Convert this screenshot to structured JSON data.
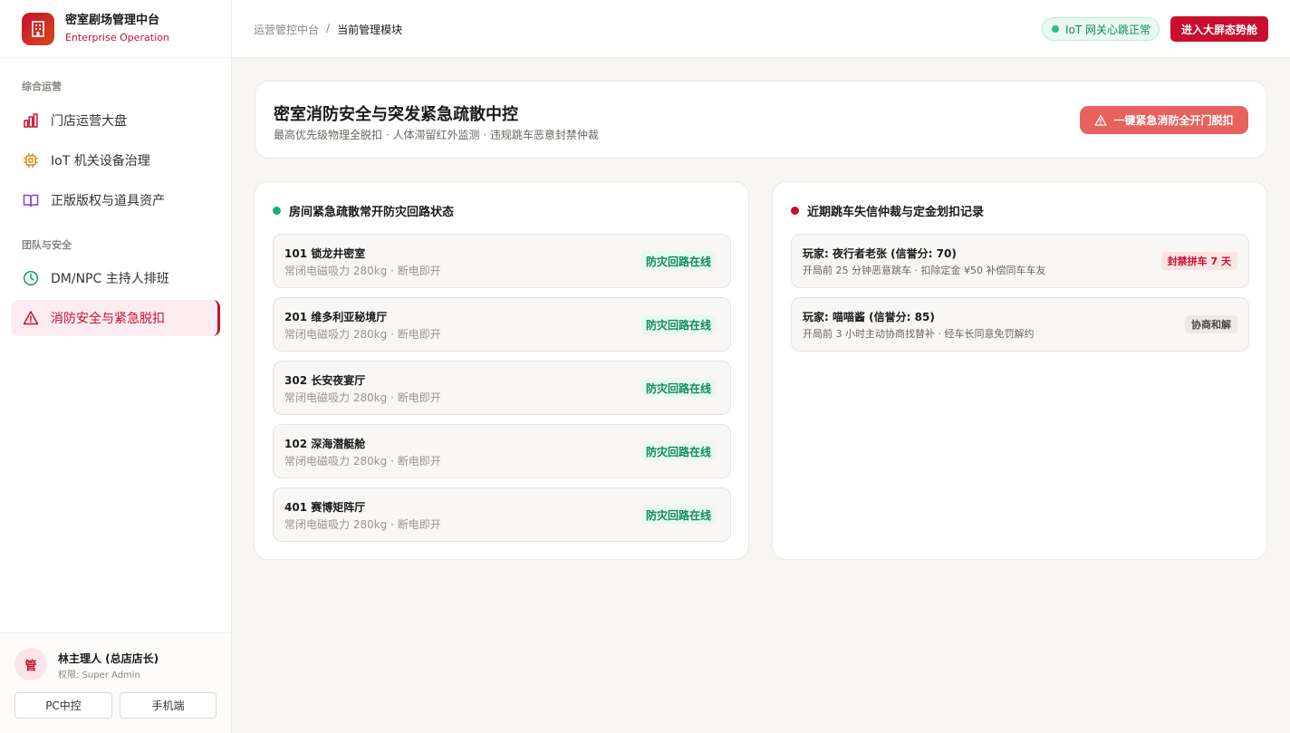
{
  "brand": {
    "title": "密室剧场管理中台",
    "subtitle": "Enterprise Operation"
  },
  "sidebar": {
    "sections": [
      {
        "label": "综合运营"
      },
      {
        "label": "团队与安全"
      }
    ],
    "items": [
      {
        "label": "门店运营大盘",
        "icon": "bar-chart-icon"
      },
      {
        "label": "IoT 机关设备治理",
        "icon": "chip-icon"
      },
      {
        "label": "正版版权与道具资产",
        "icon": "book-icon"
      },
      {
        "label": "DM/NPC 主持人排班",
        "icon": "clock-icon"
      },
      {
        "label": "消防安全与紧急脱扣",
        "icon": "warning-icon",
        "active": true
      }
    ]
  },
  "user": {
    "avatar_text": "管",
    "name": "林主理人 (总店店长)",
    "role": "权限: Super Admin",
    "buttons": [
      "PC中控",
      "手机端"
    ]
  },
  "header": {
    "breadcrumb": [
      "运营管控中台",
      "当前管理模块"
    ],
    "breadcrumb_sep": "/",
    "status": "IoT 网关心跳正常",
    "big_screen_button": "进入大屏态势舱"
  },
  "page": {
    "title": "密室消防安全与突发紧急疏散中控",
    "subtitle": "最高优先级物理全脱扣 · 人体滞留红外监测 · 违规跳车恶意封禁仲裁",
    "emergency_button": "一键紧急消防全开门脱扣"
  },
  "rooms_panel": {
    "title": "房间紧急疏散常开防灾回路状态",
    "dot_color": "#1aab74",
    "rooms": [
      {
        "name": "101 锁龙井密室",
        "desc": "常闭电磁吸力 280kg · 断电即开",
        "status": "防灾回路在线"
      },
      {
        "name": "201 维多利亚秘境厅",
        "desc": "常闭电磁吸力 280kg · 断电即开",
        "status": "防灾回路在线"
      },
      {
        "name": "302 长安夜宴厅",
        "desc": "常闭电磁吸力 280kg · 断电即开",
        "status": "防灾回路在线"
      },
      {
        "name": "102 深海潜艇舱",
        "desc": "常闭电磁吸力 280kg · 断电即开",
        "status": "防灾回路在线"
      },
      {
        "name": "401 赛博矩阵厅",
        "desc": "常闭电磁吸力 280kg · 断电即开",
        "status": "防灾回路在线"
      }
    ]
  },
  "records_panel": {
    "title": "近期跳车失信仲裁与定金划扣记录",
    "dot_color": "#c8102e",
    "records": [
      {
        "title": "玩家: 夜行者老张 (信誉分: 70)",
        "desc": "开局前 25 分钟恶意跳车 · 扣除定金 ¥50 补偿同车车友",
        "badge": "封禁拼车 7 天",
        "badge_type": "danger"
      },
      {
        "title": "玩家: 喵喵酱 (信誉分: 85)",
        "desc": "开局前 3 小时主动协商找替补 · 经车长同意免罚解约",
        "badge": "协商和解",
        "badge_type": "neutral"
      }
    ]
  }
}
